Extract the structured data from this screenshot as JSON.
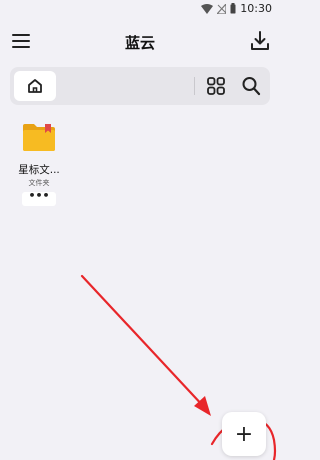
{
  "status_bar": {
    "time": "10:30"
  },
  "app_bar": {
    "title": "蓝云"
  },
  "files": [
    {
      "name": "星标文...",
      "type": "文件夹",
      "more": "•••"
    }
  ],
  "fab": {
    "label": "+"
  },
  "colors": {
    "folder": "#f7bb22",
    "folder_tab": "#e8a214",
    "star_badge": "#e04848",
    "annotation": "#e8262a"
  }
}
